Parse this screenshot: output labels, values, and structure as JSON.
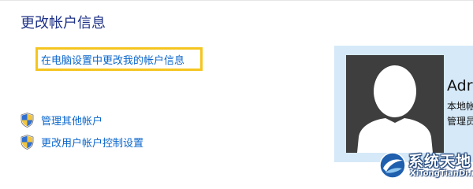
{
  "page": {
    "title": "更改帐户信息"
  },
  "main": {
    "pc_settings_link": "在电脑设置中更改我的帐户信息",
    "tasks": [
      {
        "label": "管理其他帐户",
        "icon": "uac-shield-icon"
      },
      {
        "label": "更改用户帐户控制设置",
        "icon": "uac-shield-icon"
      }
    ]
  },
  "account": {
    "name": "Adr",
    "type": "本地帐",
    "role": "管理员"
  },
  "watermark": {
    "text": "系统天地",
    "url": "XiTongTianDi.net"
  },
  "colors": {
    "title": "#1e3287",
    "link": "#0a66cc",
    "highlight_border": "#f5c51f",
    "panel_background": "#d5e9f8",
    "avatar_background": "#3e3e3e"
  }
}
